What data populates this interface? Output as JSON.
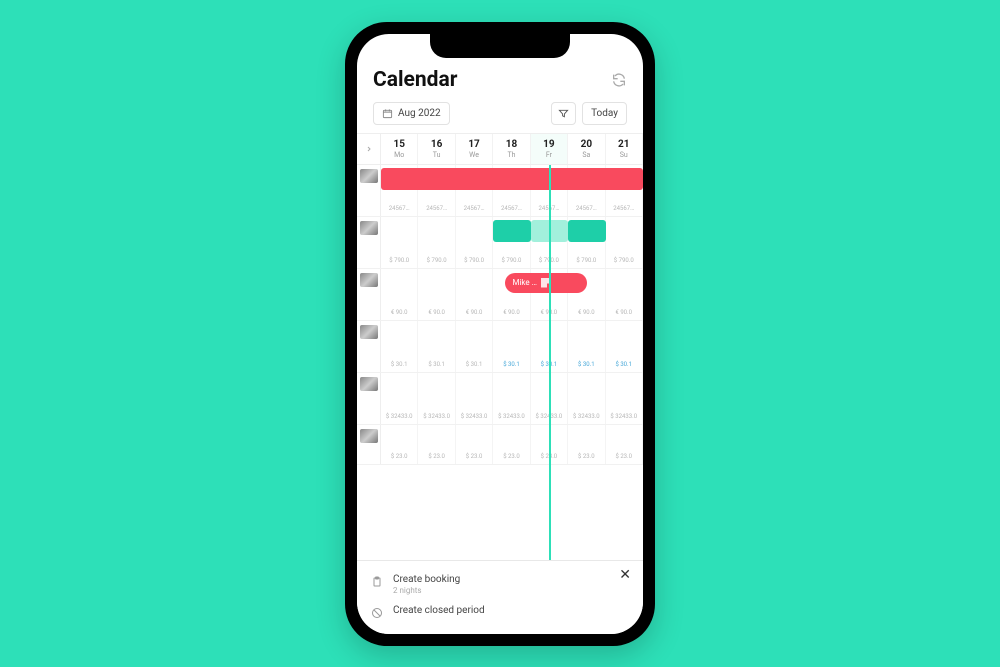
{
  "page": {
    "title": "Calendar"
  },
  "toolbar": {
    "month_label": "Aug 2022",
    "today_label": "Today"
  },
  "days": [
    {
      "num": "15",
      "abbr": "Mo",
      "today": false
    },
    {
      "num": "16",
      "abbr": "Tu",
      "today": false
    },
    {
      "num": "17",
      "abbr": "We",
      "today": false
    },
    {
      "num": "18",
      "abbr": "Th",
      "today": false
    },
    {
      "num": "19",
      "abbr": "Fr",
      "today": true
    },
    {
      "num": "20",
      "abbr": "Sa",
      "today": false
    },
    {
      "num": "21",
      "abbr": "Su",
      "today": false
    }
  ],
  "today_index": 4,
  "rows": [
    {
      "id": "prop1",
      "prices": [
        "24567…",
        "24567…",
        "24567…",
        "24567…",
        "24567…",
        "24567…",
        "24567…"
      ],
      "blue_from": null,
      "bars": [
        {
          "type": "red",
          "from": 0,
          "to": 7
        }
      ]
    },
    {
      "id": "prop2",
      "prices": [
        "$ 790.0",
        "$ 790.0",
        "$ 790.0",
        "$ 790.0",
        "$ 790.0",
        "$ 790.0",
        "$ 790.0"
      ],
      "blue_from": null,
      "bars": [
        {
          "type": "teal",
          "from": 3,
          "to": 4
        },
        {
          "type": "teal-light",
          "from": 4,
          "to": 5
        },
        {
          "type": "teal",
          "from": 5,
          "to": 6
        }
      ]
    },
    {
      "id": "prop3",
      "prices": [
        "€ 90.0",
        "€ 90.0",
        "€ 90.0",
        "€ 90.0",
        "€ 90.0",
        "€ 90.0",
        "€ 90.0"
      ],
      "blue_from": null,
      "pill": {
        "label": "Mike …",
        "from": 3.3,
        "width": 2.2
      }
    },
    {
      "id": "prop4",
      "prices": [
        "$ 30.1",
        "$ 30.1",
        "$ 30.1",
        "$ 30.1",
        "$ 30.1",
        "$ 30.1",
        "$ 30.1"
      ],
      "blue_from": 3
    },
    {
      "id": "prop5",
      "prices": [
        "$ 32433.0",
        "$ 32433.0",
        "$ 32433.0",
        "$ 32433.0",
        "$ 32433.0",
        "$ 32433.0",
        "$ 32433.0"
      ],
      "blue_from": null
    },
    {
      "id": "prop6",
      "prices": [
        "$ 23.0",
        "$ 23.0",
        "$ 23.0",
        "$ 23.0",
        "$ 23.0",
        "$ 23.0",
        "$ 23.0"
      ],
      "blue_from": null,
      "short": true
    }
  ],
  "sheet": {
    "create_booking": "Create booking",
    "nights": "2 nights",
    "create_closed": "Create closed period"
  }
}
